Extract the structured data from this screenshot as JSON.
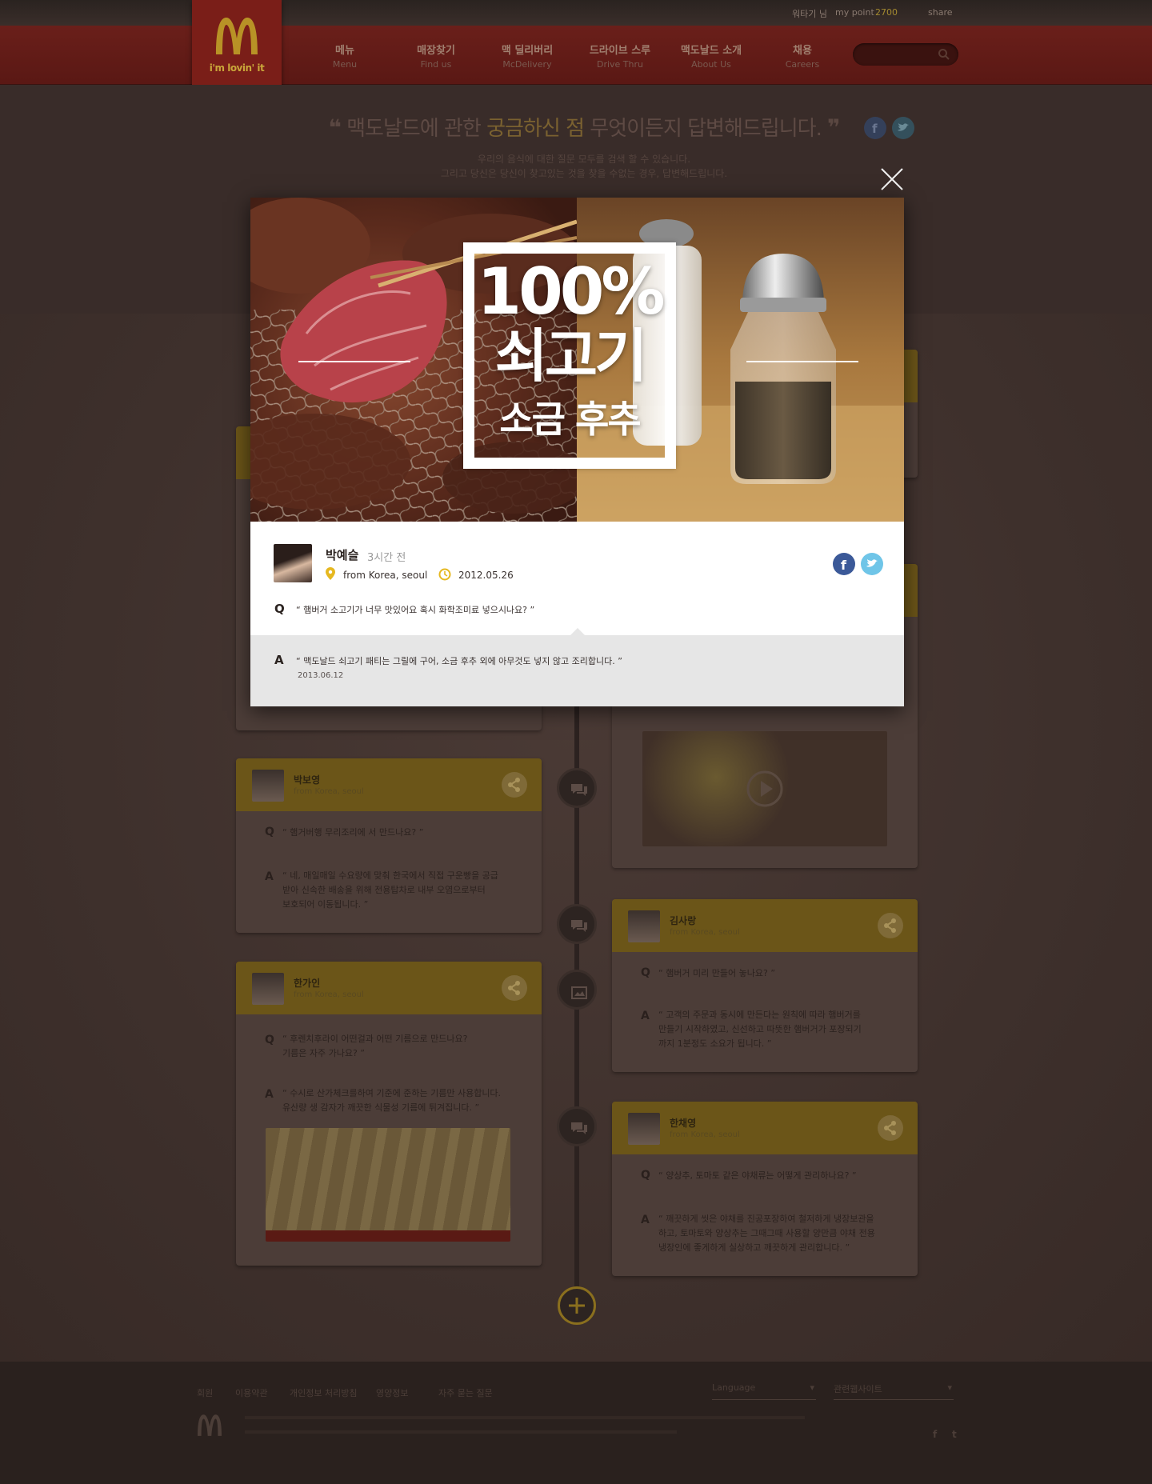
{
  "header": {
    "user_link": "워타기 님",
    "point_label": "my point",
    "point_value": "2700",
    "share_label": "share",
    "logo_tagline": "i'm lovin' it",
    "nav": [
      {
        "ko": "메뉴",
        "en": "Menu"
      },
      {
        "ko": "매장찾기",
        "en": "Find us"
      },
      {
        "ko": "맥 딜리버리",
        "en": "McDelivery"
      },
      {
        "ko": "드라이브 스루",
        "en": "Drive Thru"
      },
      {
        "ko": "맥도날드 소개",
        "en": "About Us"
      },
      {
        "ko": "채용",
        "en": "Careers"
      }
    ],
    "search_placeholder": ""
  },
  "hero": {
    "open_quote": "❝",
    "headline_pre": "맥도날드에 관한 ",
    "headline_highlight": "궁금하신 점",
    "headline_post": " 무엇이든지 답변해드립니다.",
    "close_quote": "❞",
    "sub_line1": "우리의 음식에 대한 질문 모두를 검색 할 수 있습니다.",
    "sub_line2": "그리고 당신은 당신이 찾고있는 것을 찾을 수없는 경우, 답변해드립니다."
  },
  "modal": {
    "banner_line1": "100%",
    "banner_line2": "쇠고기",
    "banner_line3": "소금 후추",
    "author": "박예슬",
    "time_ago": "3시간 전",
    "location": "from Korea, seoul",
    "date": "2012.05.26",
    "q_label": "Q",
    "question": "“ 햄버거 소고기가 너무 맛있어요 혹시 화학조미료 넣으시나요? ”",
    "a_label": "A",
    "answer": "“ 맥도날드 쇠고기 패티는 그릴에 구어, 소금 후추 외에 아무것도 넣지 않고 조리합니다. ”",
    "answer_date": "2013.06.12"
  },
  "cards": [
    {
      "name": "박보영",
      "from": "from Korea, seoul",
      "q_label": "Q",
      "question": "“ 햄거버행 무리조리에 서 만드나요? ”",
      "a_label": "A",
      "answer1": "“ 네, 매일매일 수요량에 맞춰 한국에서 직접 구운빵을 공급",
      "answer2": "받아 신속한 배송을 위해 전용탑차로 내부 오염으로부터",
      "answer3": "보호되어 이동됩니다. ”"
    },
    {
      "name": "한가인",
      "from": "from Korea, seoul",
      "q_label": "Q",
      "question": "“ 후렌치후라이 어떤걸과 어떤 기름으로 만드나요?",
      "question2": "기름은 자주 가나요? ”",
      "a_label": "A",
      "answer1": "“ 수시로 산가체크를하여 기준에 준하는 기름만 사용합니다.",
      "answer2": "유산량 생 감자가 깨끗한 식물성 기름에 튀겨집니다. ”"
    },
    {
      "name": "김사랑",
      "from": "from Korea, seoul",
      "q_label": "Q",
      "question": "“ 햄버거 미리 만들어 놓나요? ”",
      "a_label": "A",
      "answer1": "“ 고객의 주문과 동시에 만든다는 원칙에 따라 햄버거를",
      "answer2": "만들기 시작하였고, 신선하고 따뜻한 햄버거가 포장되기",
      "answer3": "까지 1분정도 소요가 됩니다. ”"
    },
    {
      "name": "한채영",
      "from": "from Korea, seoul",
      "q_label": "Q",
      "question": "“ 양상추, 토마토 같은 야채류는 어떻게 관리하나요? ”",
      "a_label": "A",
      "answer1": "“ 깨끗하게 씻은 야채를 진공포장하여 철저하게 냉장보관을",
      "answer2": "하고, 토마토와 양상추는 그때그때 사용할 양만큼 야채 전용",
      "answer3": "냉장인에 좋게하게 실상하고 깨끗하게 관리합니다. ”"
    }
  ],
  "footer": {
    "links": [
      "회원",
      "이용약관",
      "개인정보 처리방침",
      "영양정보",
      "자주 묻는 질문"
    ],
    "language": "Language",
    "family_site": "관련웹사이트"
  },
  "colors": {
    "accent_yellow": "#c9a63a",
    "brand_red": "#6a1f1a",
    "facebook": "#3b5998",
    "twitter": "#4fb5e0"
  }
}
